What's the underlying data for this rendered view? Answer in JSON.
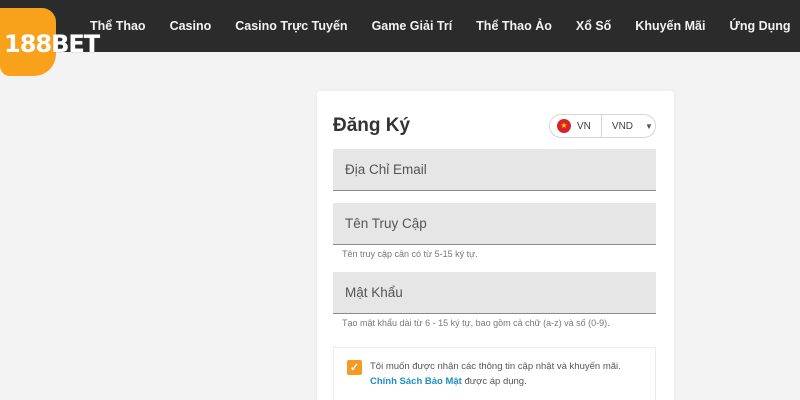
{
  "brand": {
    "logo_num": "188",
    "logo_bet": "BET",
    "accent": "#f8a21b"
  },
  "nav": {
    "items": [
      "Thể Thao",
      "Casino",
      "Casino Trực Tuyến",
      "Game Giải Trí",
      "Thể Thao Ảo",
      "Xổ Số",
      "Khuyến Mãi",
      "Ứng Dụng"
    ]
  },
  "register": {
    "title": "Đăng Ký",
    "locale": {
      "lang": "VN",
      "currency": "VND",
      "flag_icon": "vietnam-flag-icon"
    },
    "email": {
      "placeholder": "Địa Chỉ Email"
    },
    "username": {
      "placeholder": "Tên Truy Cập",
      "hint": "Tên truy cập cần có từ 5-15 ký tự."
    },
    "password": {
      "placeholder": "Mật Khẩu",
      "hint": "Tạo mật khẩu dài từ 6 - 15 ký tự, bao gồm cả chữ (a-z) và số (0-9)."
    },
    "consent": {
      "checked": true,
      "text_before": "Tôi muốn được nhận các thông tin cập nhật và khuyến mãi.",
      "link": "Chính Sách Bảo Mật",
      "text_after": "được áp dụng."
    }
  },
  "colors": {
    "topbar": "#2b2b2b",
    "checkbox": "#f59a23",
    "link": "#1f8ec7"
  }
}
